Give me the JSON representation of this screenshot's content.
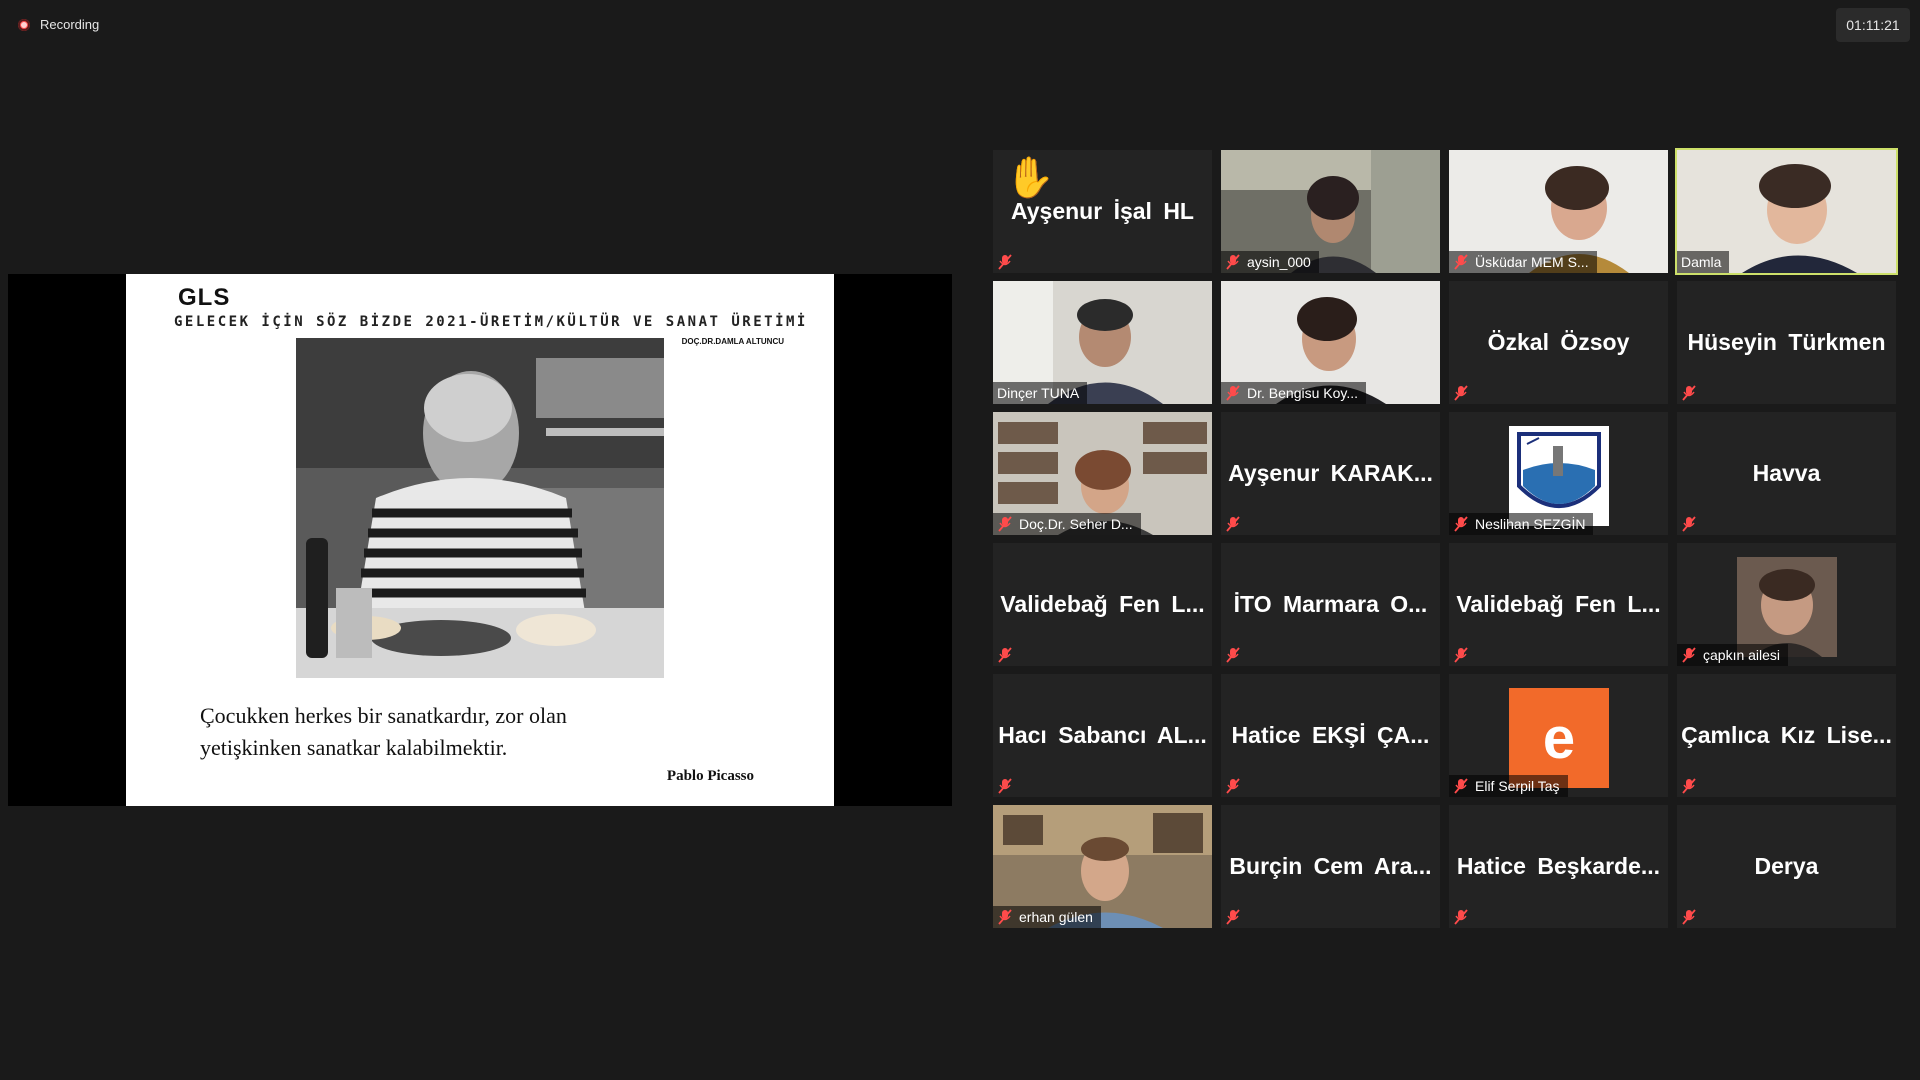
{
  "recording": {
    "label": "Recording"
  },
  "timer": {
    "value": "01:11:21"
  },
  "slide": {
    "logo": "GLS",
    "title": "GELECEK  İÇİN  SÖZ  BİZDE 2021-ÜRETİM/KÜLTÜR VE SANAT ÜRETİMİ",
    "author": "DOÇ.DR.DAMLA ALTUNCU",
    "quote_line1": "Çocukken herkes bir sanatkardır, zor olan",
    "quote_line2": "yetişkinken sanatkar kalabilmektir.",
    "quote_author": "Pablo Picasso"
  },
  "participants": [
    {
      "display": "Ayşenur İşal HL",
      "tag": ""
    },
    {
      "display": "",
      "tag": "aysin_000"
    },
    {
      "display": "",
      "tag": "Üsküdar MEM S..."
    },
    {
      "display": "",
      "tag": "Damla"
    },
    {
      "display": "",
      "tag": "Dinçer TUNA"
    },
    {
      "display": "",
      "tag": "Dr. Bengisu Koy..."
    },
    {
      "display": "Özkal Özsoy",
      "tag": ""
    },
    {
      "display": "Hüseyin Türkmen",
      "tag": ""
    },
    {
      "display": "",
      "tag": "Doç.Dr. Seher D..."
    },
    {
      "display": "Ayşenur KARAK...",
      "tag": ""
    },
    {
      "display": "",
      "tag": "Neslihan SEZGİN"
    },
    {
      "display": "Havva",
      "tag": ""
    },
    {
      "display": "Validebağ Fen L...",
      "tag": ""
    },
    {
      "display": "İTO Marmara O...",
      "tag": ""
    },
    {
      "display": "Validebağ Fen L...",
      "tag": ""
    },
    {
      "display": "",
      "tag": "çapkın ailesi"
    },
    {
      "display": "Hacı Sabancı AL...",
      "tag": ""
    },
    {
      "display": "Hatice EKŞİ ÇA...",
      "tag": ""
    },
    {
      "display": "",
      "tag": "Elif Serpil Taş",
      "avatar_letter": "e"
    },
    {
      "display": "Çamlıca Kız Lise...",
      "tag": ""
    },
    {
      "display": "",
      "tag": "erhan gülen"
    },
    {
      "display": "Burçin Cem Ara...",
      "tag": ""
    },
    {
      "display": "Hatice Beşkarde...",
      "tag": ""
    },
    {
      "display": "Derya",
      "tag": ""
    }
  ],
  "colors": {
    "active_speaker": "#cde06a",
    "muted_icon": "#ff4b4b",
    "avatar_orange": "#f26a2a",
    "background": "#1a1a1a"
  },
  "icons": {
    "recording": "record-dot-icon",
    "muted": "mic-muted-icon",
    "raised_hand": "raised-hand-icon"
  }
}
